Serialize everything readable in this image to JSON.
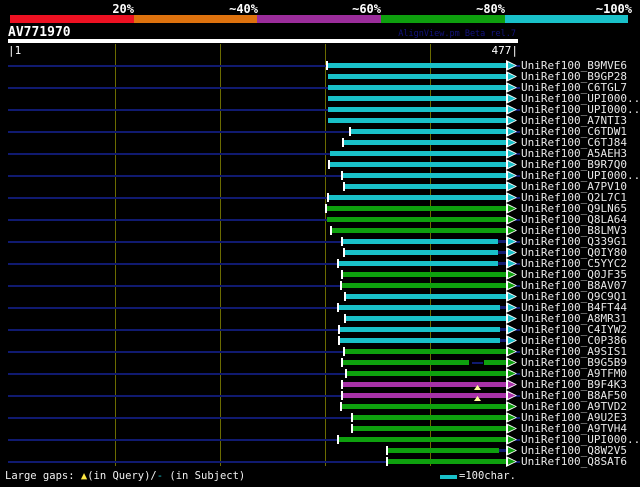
{
  "header": {
    "query_id": "AV771970",
    "watermark": "AlignView.pm Beta rel.7"
  },
  "scale_bar": {
    "labels": [
      "20%",
      "~40%",
      "~60%",
      "~80%",
      "~100%"
    ],
    "colors": [
      "#ee1122",
      "#de720e",
      "#9b2d9b",
      "#0ea00e",
      "#19c1c9"
    ]
  },
  "ruler": {
    "start_label": "|1",
    "end_label": "477|",
    "query_length": 477,
    "tick_positions": [
      100,
      200,
      300,
      400
    ]
  },
  "colors": {
    "bars": {
      "cyan": "#19c1c9",
      "green": "#0ea00e",
      "magenta": "#a832a8"
    },
    "guide": "#101a70",
    "grid": "#6b6b00",
    "marker": "#ffff9c"
  },
  "legend": {
    "gaps_prefix": "Large gaps: ",
    "gap_query_symbol": "▲",
    "gaps_mid": "(in Query)/",
    "gap_subject_symbol": "-",
    "gaps_suffix": " (in Subject)",
    "scale_label": "=100char."
  },
  "rows": [
    {
      "label": "UniRef100_B9MVE6",
      "color": "cyan",
      "x": 328,
      "tick": true
    },
    {
      "label": "UniRef100_B9GP28",
      "color": "cyan",
      "x": 328,
      "tick": false
    },
    {
      "label": "UniRef100_C6TGL7",
      "color": "cyan",
      "x": 328,
      "tick": false
    },
    {
      "label": "UniRef100_UPI000..",
      "color": "cyan",
      "x": 328,
      "tick": false
    },
    {
      "label": "UniRef100_UPI000..",
      "color": "cyan",
      "x": 328,
      "tick": false
    },
    {
      "label": "UniRef100_A7NTI3",
      "color": "cyan",
      "x": 328,
      "tick": false
    },
    {
      "label": "UniRef100_C6TDW1",
      "color": "cyan",
      "x": 351,
      "tick": true
    },
    {
      "label": "UniRef100_C6TJ84",
      "color": "cyan",
      "x": 344,
      "tick": true
    },
    {
      "label": "UniRef100_A5AEH3",
      "color": "cyan",
      "x": 330,
      "tick": false
    },
    {
      "label": "UniRef100_B9R7Q0",
      "color": "cyan",
      "x": 330,
      "tick": true
    },
    {
      "label": "UniRef100_UPI000..",
      "color": "cyan",
      "x": 343,
      "tick": true
    },
    {
      "label": "UniRef100_A7PV10",
      "color": "cyan",
      "x": 345,
      "tick": true
    },
    {
      "label": "UniRef100_Q2L7C1",
      "color": "cyan",
      "x": 329,
      "tick": true
    },
    {
      "label": "UniRef100_Q9LN65",
      "color": "green",
      "x": 327,
      "tick": true
    },
    {
      "label": "UniRef100_Q8LA64",
      "color": "green",
      "x": 327,
      "tick": false
    },
    {
      "label": "UniRef100_B8LMV3",
      "color": "green",
      "x": 332,
      "tick": true
    },
    {
      "label": "UniRef100_Q339G1",
      "color": "cyan",
      "x": 343,
      "tick": true,
      "tail": 498
    },
    {
      "label": "UniRef100_Q0IY80",
      "color": "cyan",
      "x": 345,
      "tick": true,
      "tail": 498
    },
    {
      "label": "UniRef100_C5YYC2",
      "color": "cyan",
      "x": 339,
      "tick": true,
      "tail": 498
    },
    {
      "label": "UniRef100_Q0JF35",
      "color": "green",
      "x": 343,
      "tick": true
    },
    {
      "label": "UniRef100_B8AV07",
      "color": "green",
      "x": 342,
      "tick": true
    },
    {
      "label": "UniRef100_Q9C9Q1",
      "color": "cyan",
      "x": 346,
      "tick": true
    },
    {
      "label": "UniRef100_B4FT44",
      "color": "cyan",
      "x": 339,
      "tick": true,
      "tail": 500
    },
    {
      "label": "UniRef100_A8MR31",
      "color": "cyan",
      "x": 346,
      "tick": true
    },
    {
      "label": "UniRef100_C4IYW2",
      "color": "cyan",
      "x": 340,
      "tick": true,
      "tail": 500
    },
    {
      "label": "UniRef100_C0P386",
      "color": "cyan",
      "x": 340,
      "tick": true,
      "tail": 500
    },
    {
      "label": "UniRef100_A9SIS1",
      "color": "green",
      "x": 345,
      "tick": true
    },
    {
      "label": "UniRef100_B9G5B9",
      "color": "green",
      "x": 343,
      "tick": true,
      "gap": [
        469,
        484
      ],
      "gap_line": [
        472,
        483
      ]
    },
    {
      "label": "UniRef100_A9TFM0",
      "color": "green",
      "x": 347,
      "tick": true
    },
    {
      "label": "UniRef100_B9F4K3",
      "color": "magenta",
      "x": 343,
      "tick": true,
      "marker": 477
    },
    {
      "label": "UniRef100_B8AF50",
      "color": "magenta",
      "x": 343,
      "tick": true,
      "marker": 477
    },
    {
      "label": "UniRef100_A9TVD2",
      "color": "green",
      "x": 342,
      "tick": true
    },
    {
      "label": "UniRef100_A9U2E3",
      "color": "green",
      "x": 353,
      "tick": true
    },
    {
      "label": "UniRef100_A9TVH4",
      "color": "green",
      "x": 353,
      "tick": true
    },
    {
      "label": "UniRef100_UPI000..",
      "color": "green",
      "x": 339,
      "tick": true
    },
    {
      "label": "UniRef100_Q8W2V5",
      "color": "green",
      "x": 388,
      "tick": true,
      "tail": 499
    },
    {
      "label": "UniRef100_Q8SAT6",
      "color": "green",
      "x": 388,
      "tick": true
    }
  ],
  "chart_data": {
    "type": "bar",
    "title": "AV771970",
    "xlabel": "query position",
    "x_range": [
      1,
      477
    ],
    "x_ticks": [
      100,
      200,
      300,
      400
    ],
    "legend_bins": [
      {
        "label": "20%",
        "color": "#ee1122"
      },
      {
        "label": "~40%",
        "color": "#de720e"
      },
      {
        "label": "~60%",
        "color": "#9b2d9b"
      },
      {
        "label": "~80%",
        "color": "#0ea00e"
      },
      {
        "label": "~100%",
        "color": "#19c1c9"
      }
    ],
    "series": [
      {
        "name": "UniRef100_B9MVE6",
        "q_start": 300,
        "q_end": 477,
        "identity_bin": "~100%"
      },
      {
        "name": "UniRef100_B9GP28",
        "q_start": 300,
        "q_end": 477,
        "identity_bin": "~100%"
      },
      {
        "name": "UniRef100_C6TGL7",
        "q_start": 300,
        "q_end": 477,
        "identity_bin": "~100%"
      },
      {
        "name": "UniRef100_UPI000..",
        "q_start": 300,
        "q_end": 477,
        "identity_bin": "~100%"
      },
      {
        "name": "UniRef100_UPI000..",
        "q_start": 300,
        "q_end": 477,
        "identity_bin": "~100%"
      },
      {
        "name": "UniRef100_A7NTI3",
        "q_start": 300,
        "q_end": 477,
        "identity_bin": "~100%"
      },
      {
        "name": "UniRef100_C6TDW1",
        "q_start": 321,
        "q_end": 477,
        "identity_bin": "~100%"
      },
      {
        "name": "UniRef100_C6TJ84",
        "q_start": 315,
        "q_end": 477,
        "identity_bin": "~100%"
      },
      {
        "name": "UniRef100_A5AEH3",
        "q_start": 302,
        "q_end": 477,
        "identity_bin": "~100%"
      },
      {
        "name": "UniRef100_B9R7Q0",
        "q_start": 302,
        "q_end": 477,
        "identity_bin": "~100%"
      },
      {
        "name": "UniRef100_UPI000..",
        "q_start": 314,
        "q_end": 477,
        "identity_bin": "~100%"
      },
      {
        "name": "UniRef100_A7PV10",
        "q_start": 316,
        "q_end": 477,
        "identity_bin": "~100%"
      },
      {
        "name": "UniRef100_Q2L7C1",
        "q_start": 301,
        "q_end": 477,
        "identity_bin": "~100%"
      },
      {
        "name": "UniRef100_Q9LN65",
        "q_start": 299,
        "q_end": 477,
        "identity_bin": "~80%"
      },
      {
        "name": "UniRef100_Q8LA64",
        "q_start": 299,
        "q_end": 477,
        "identity_bin": "~80%"
      },
      {
        "name": "UniRef100_B8LMV3",
        "q_start": 304,
        "q_end": 477,
        "identity_bin": "~80%"
      },
      {
        "name": "UniRef100_Q339G1",
        "q_start": 314,
        "q_end": 477,
        "identity_bin": "~100%"
      },
      {
        "name": "UniRef100_Q0IY80",
        "q_start": 316,
        "q_end": 477,
        "identity_bin": "~100%"
      },
      {
        "name": "UniRef100_C5YYC2",
        "q_start": 310,
        "q_end": 477,
        "identity_bin": "~100%"
      },
      {
        "name": "UniRef100_Q0JF35",
        "q_start": 314,
        "q_end": 477,
        "identity_bin": "~80%"
      },
      {
        "name": "UniRef100_B8AV07",
        "q_start": 313,
        "q_end": 477,
        "identity_bin": "~80%"
      },
      {
        "name": "UniRef100_Q9C9Q1",
        "q_start": 317,
        "q_end": 477,
        "identity_bin": "~100%"
      },
      {
        "name": "UniRef100_B4FT44",
        "q_start": 310,
        "q_end": 477,
        "identity_bin": "~100%"
      },
      {
        "name": "UniRef100_A8MR31",
        "q_start": 317,
        "q_end": 477,
        "identity_bin": "~100%"
      },
      {
        "name": "UniRef100_C4IYW2",
        "q_start": 311,
        "q_end": 477,
        "identity_bin": "~100%"
      },
      {
        "name": "UniRef100_C0P386",
        "q_start": 311,
        "q_end": 477,
        "identity_bin": "~100%"
      },
      {
        "name": "UniRef100_A9SIS1",
        "q_start": 316,
        "q_end": 477,
        "identity_bin": "~80%"
      },
      {
        "name": "UniRef100_B9G5B9",
        "q_start": 314,
        "q_end": 477,
        "identity_bin": "~80%"
      },
      {
        "name": "UniRef100_A9TFM0",
        "q_start": 318,
        "q_end": 477,
        "identity_bin": "~80%"
      },
      {
        "name": "UniRef100_B9F4K3",
        "q_start": 314,
        "q_end": 477,
        "identity_bin": "~60%"
      },
      {
        "name": "UniRef100_B8AF50",
        "q_start": 314,
        "q_end": 477,
        "identity_bin": "~60%"
      },
      {
        "name": "UniRef100_A9TVD2",
        "q_start": 313,
        "q_end": 477,
        "identity_bin": "~80%"
      },
      {
        "name": "UniRef100_A9U2E3",
        "q_start": 323,
        "q_end": 477,
        "identity_bin": "~80%"
      },
      {
        "name": "UniRef100_A9TVH4",
        "q_start": 323,
        "q_end": 477,
        "identity_bin": "~80%"
      },
      {
        "name": "UniRef100_UPI000..",
        "q_start": 310,
        "q_end": 477,
        "identity_bin": "~80%"
      },
      {
        "name": "UniRef100_Q8W2V5",
        "q_start": 356,
        "q_end": 477,
        "identity_bin": "~80%"
      },
      {
        "name": "UniRef100_Q8SAT6",
        "q_start": 356,
        "q_end": 477,
        "identity_bin": "~80%"
      }
    ]
  }
}
